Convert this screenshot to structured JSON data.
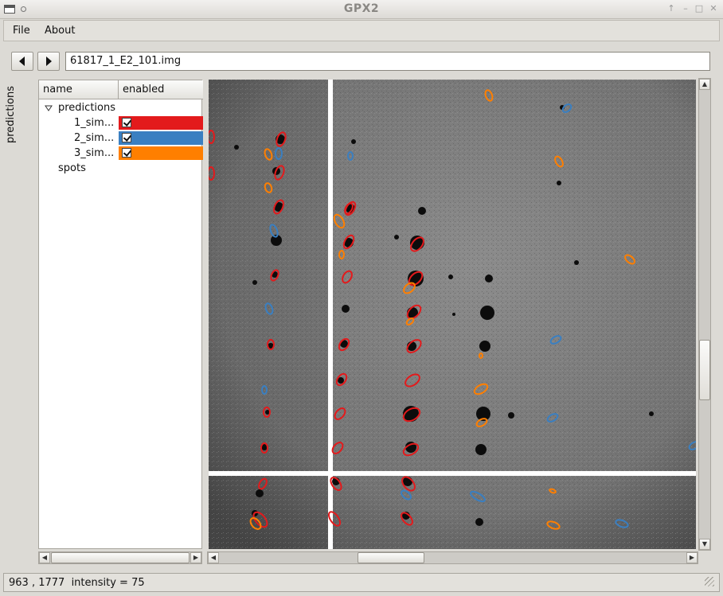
{
  "window": {
    "title": "GPX2"
  },
  "menu": {
    "file": "File",
    "about": "About"
  },
  "nav": {
    "prev_icon": "triangle-left-icon",
    "next_icon": "triangle-right-icon",
    "filename": "61817_1_E2_101.img"
  },
  "side_tab": {
    "label": "predictions"
  },
  "tree": {
    "col_name": "name",
    "col_enabled": "enabled",
    "root": "predictions",
    "items": [
      {
        "label": "1_sim...",
        "color": "#e31a1c",
        "enabled": true
      },
      {
        "label": "2_sim...",
        "color": "#3a7fc1",
        "enabled": true
      },
      {
        "label": "3_sim...",
        "color": "#ff7f00",
        "enabled": true
      }
    ],
    "spots": "spots"
  },
  "status": {
    "coords": "963 , 1777",
    "intensity": "intensity = 75"
  }
}
